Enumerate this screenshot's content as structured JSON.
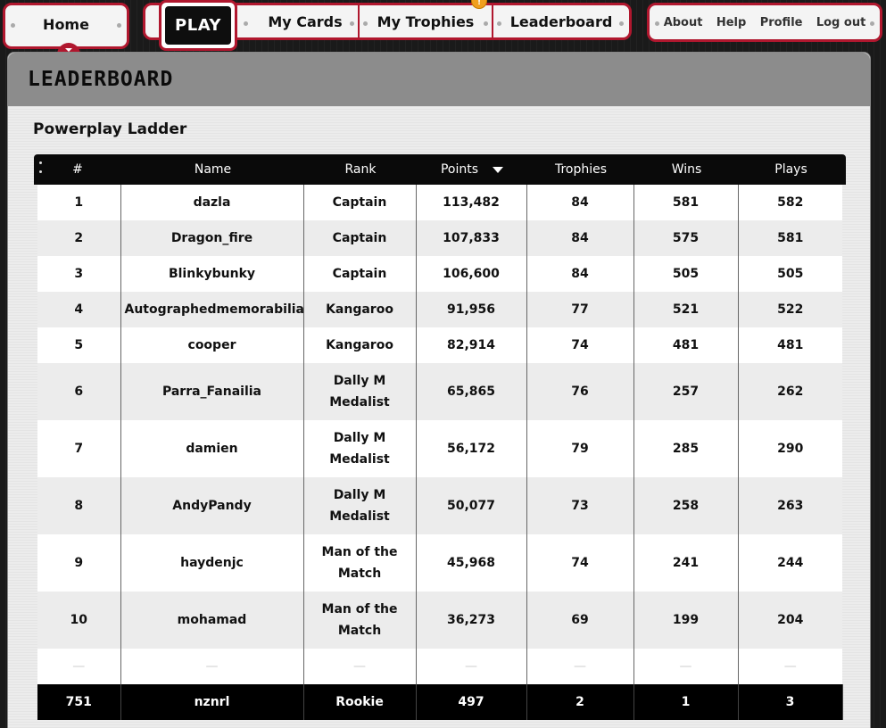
{
  "nav": {
    "home": "Home",
    "play": "PLAY",
    "tabs": [
      {
        "label": "My Cards"
      },
      {
        "label": "My Trophies"
      },
      {
        "label": "Leaderboard"
      }
    ],
    "trophy_badge": "!",
    "right_links": [
      {
        "label": "About"
      },
      {
        "label": "Help"
      },
      {
        "label": "Profile"
      },
      {
        "label": "Log out"
      }
    ]
  },
  "panel": {
    "title": "LEADERBOARD",
    "subtitle": "Powerplay Ladder"
  },
  "table": {
    "headers": [
      "#",
      "Name",
      "Rank",
      "Points",
      "Trophies",
      "Wins",
      "Plays"
    ],
    "rows": [
      {
        "n": "1",
        "name": "dazla",
        "rank": "Captain",
        "points": "113,482",
        "trophies": "84",
        "wins": "581",
        "plays": "582"
      },
      {
        "n": "2",
        "name": "Dragon_fire",
        "rank": "Captain",
        "points": "107,833",
        "trophies": "84",
        "wins": "575",
        "plays": "581"
      },
      {
        "n": "3",
        "name": "Blinkybunky",
        "rank": "Captain",
        "points": "106,600",
        "trophies": "84",
        "wins": "505",
        "plays": "505"
      },
      {
        "n": "4",
        "name": "Autographedmemorabilia",
        "rank": "Kangaroo",
        "points": "91,956",
        "trophies": "77",
        "wins": "521",
        "plays": "522"
      },
      {
        "n": "5",
        "name": "cooper",
        "rank": "Kangaroo",
        "points": "82,914",
        "trophies": "74",
        "wins": "481",
        "plays": "481"
      },
      {
        "n": "6",
        "name": "Parra_Fanailia",
        "rank": "Dally M Medalist",
        "points": "65,865",
        "trophies": "76",
        "wins": "257",
        "plays": "262"
      },
      {
        "n": "7",
        "name": "damien",
        "rank": "Dally M Medalist",
        "points": "56,172",
        "trophies": "79",
        "wins": "285",
        "plays": "290"
      },
      {
        "n": "8",
        "name": "AndyPandy",
        "rank": "Dally M Medalist",
        "points": "50,077",
        "trophies": "73",
        "wins": "258",
        "plays": "263"
      },
      {
        "n": "9",
        "name": "haydenjc",
        "rank": "Man of the Match",
        "points": "45,968",
        "trophies": "74",
        "wins": "241",
        "plays": "244"
      },
      {
        "n": "10",
        "name": "mohamad",
        "rank": "Man of the Match",
        "points": "36,273",
        "trophies": "69",
        "wins": "199",
        "plays": "204"
      }
    ],
    "gap_placeholder": "—",
    "me": {
      "n": "751",
      "name": "nznrl",
      "rank": "Rookie",
      "points": "497",
      "trophies": "2",
      "wins": "1",
      "plays": "3"
    }
  },
  "colors": {
    "accent": "#b0172e",
    "header_bg": "#8c8c8c",
    "badge": "#f0a020"
  }
}
